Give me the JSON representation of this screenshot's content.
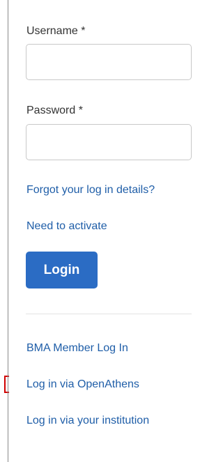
{
  "form": {
    "username_label": "Username *",
    "username_value": "",
    "password_label": "Password *",
    "password_value": "",
    "forgot_link": "Forgot your log in details?",
    "activate_link": "Need to activate",
    "login_button": "Login"
  },
  "alt_login": {
    "bma_link": "BMA Member Log In",
    "openathens_link": "Log in via OpenAthens",
    "institution_link": "Log in via your institution"
  },
  "colors": {
    "link": "#1f5ea8",
    "button": "#2b6cc4",
    "highlight_marker": "#d10000"
  }
}
